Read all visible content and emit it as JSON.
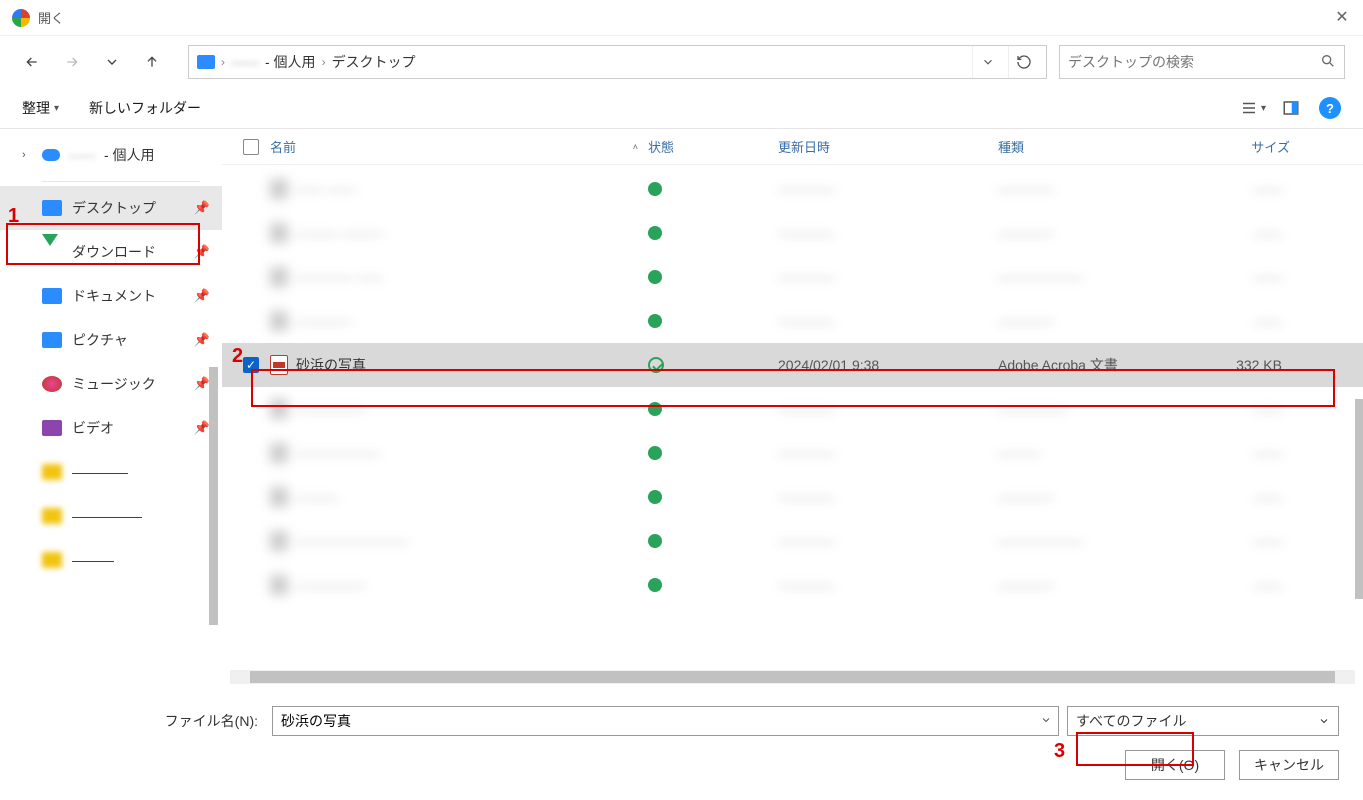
{
  "window": {
    "title": "開く"
  },
  "breadcrumb": {
    "part1_blur": "——",
    "part2": "- 個人用",
    "part3": "デスクトップ"
  },
  "search": {
    "placeholder": "デスクトップの検索"
  },
  "toolbar": {
    "organize": "整理",
    "newfolder": "新しいフォルダー"
  },
  "tree": {
    "root_suffix": "- 個人用"
  },
  "quick": {
    "desktop": "デスクトップ",
    "downloads": "ダウンロード",
    "documents": "ドキュメント",
    "pictures": "ピクチャ",
    "music": "ミュージック",
    "videos": "ビデオ"
  },
  "columns": {
    "name": "名前",
    "state": "状態",
    "date": "更新日時",
    "type": "種類",
    "size": "サイズ"
  },
  "selected_file": {
    "name": "砂浜の写真",
    "date": "2024/02/01 9:38",
    "type": "Adobe Acroba 文書",
    "size": "332 KB"
  },
  "filename": {
    "label": "ファイル名(N):",
    "value": "砂浜の写真"
  },
  "filter": {
    "label": "すべてのファイル"
  },
  "buttons": {
    "open": "開く(O)",
    "cancel": "キャンセル"
  },
  "annotations": {
    "n1": "1",
    "n2": "2",
    "n3": "3"
  }
}
